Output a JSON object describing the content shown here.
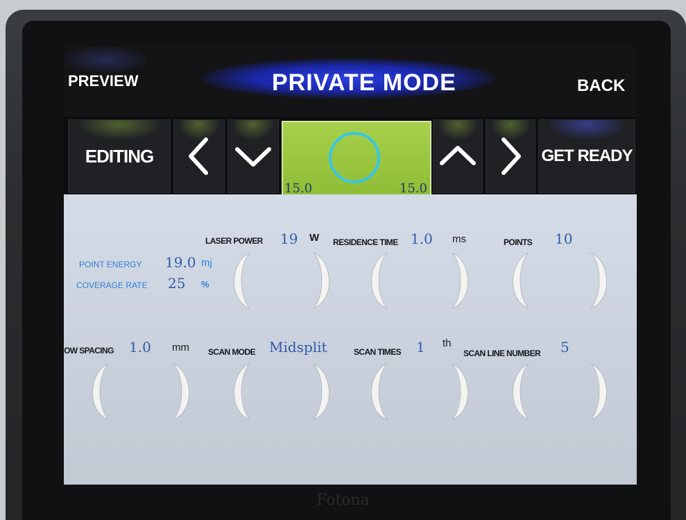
{
  "header": {
    "preview_label": "PREVIEW",
    "title": "PRIVATE MODE",
    "back_label": "BACK"
  },
  "toolbar": {
    "editing_label": "EDITING",
    "get_ready_label": "GET READY",
    "preview_left_value": "15.0",
    "preview_right_value": "15.0"
  },
  "left_info": {
    "point_energy_label": "POINT ENERGY",
    "point_energy_value": "19.0",
    "point_energy_unit": "mj",
    "coverage_rate_label": "COVERAGE RATE",
    "coverage_rate_value": "25",
    "coverage_rate_unit": "%"
  },
  "row1": [
    {
      "label": "LASER POWER",
      "value": "19",
      "unit": "W"
    },
    {
      "label": "RESIDENCE TIME",
      "value": "1.0",
      "unit": "ms"
    },
    {
      "label": "POINTS",
      "value": "10",
      "unit": ""
    }
  ],
  "row2": [
    {
      "label": "ROW SPACING",
      "value": "1.0",
      "unit": "mm"
    },
    {
      "label": "SCAN MODE",
      "value": "Midsplit",
      "unit": ""
    },
    {
      "label": "SCAN TIMES",
      "value": "1",
      "unit": "th"
    },
    {
      "label": "SCAN LINE NUMBER",
      "value": "5",
      "unit": ""
    }
  ],
  "device": {
    "brand": "Fotona"
  },
  "colors": {
    "panel_bg": "#d4dce8",
    "value_blue": "#2f5aa8",
    "preview_green": "#a7d04c",
    "circle_cyan": "#38c6e6",
    "title_glow": "#2d3fe0"
  },
  "icons": [
    "chevron-left-icon",
    "chevron-down-icon",
    "chevron-up-icon",
    "chevron-right-icon",
    "decrease-bracket-icon",
    "increase-bracket-icon"
  ]
}
